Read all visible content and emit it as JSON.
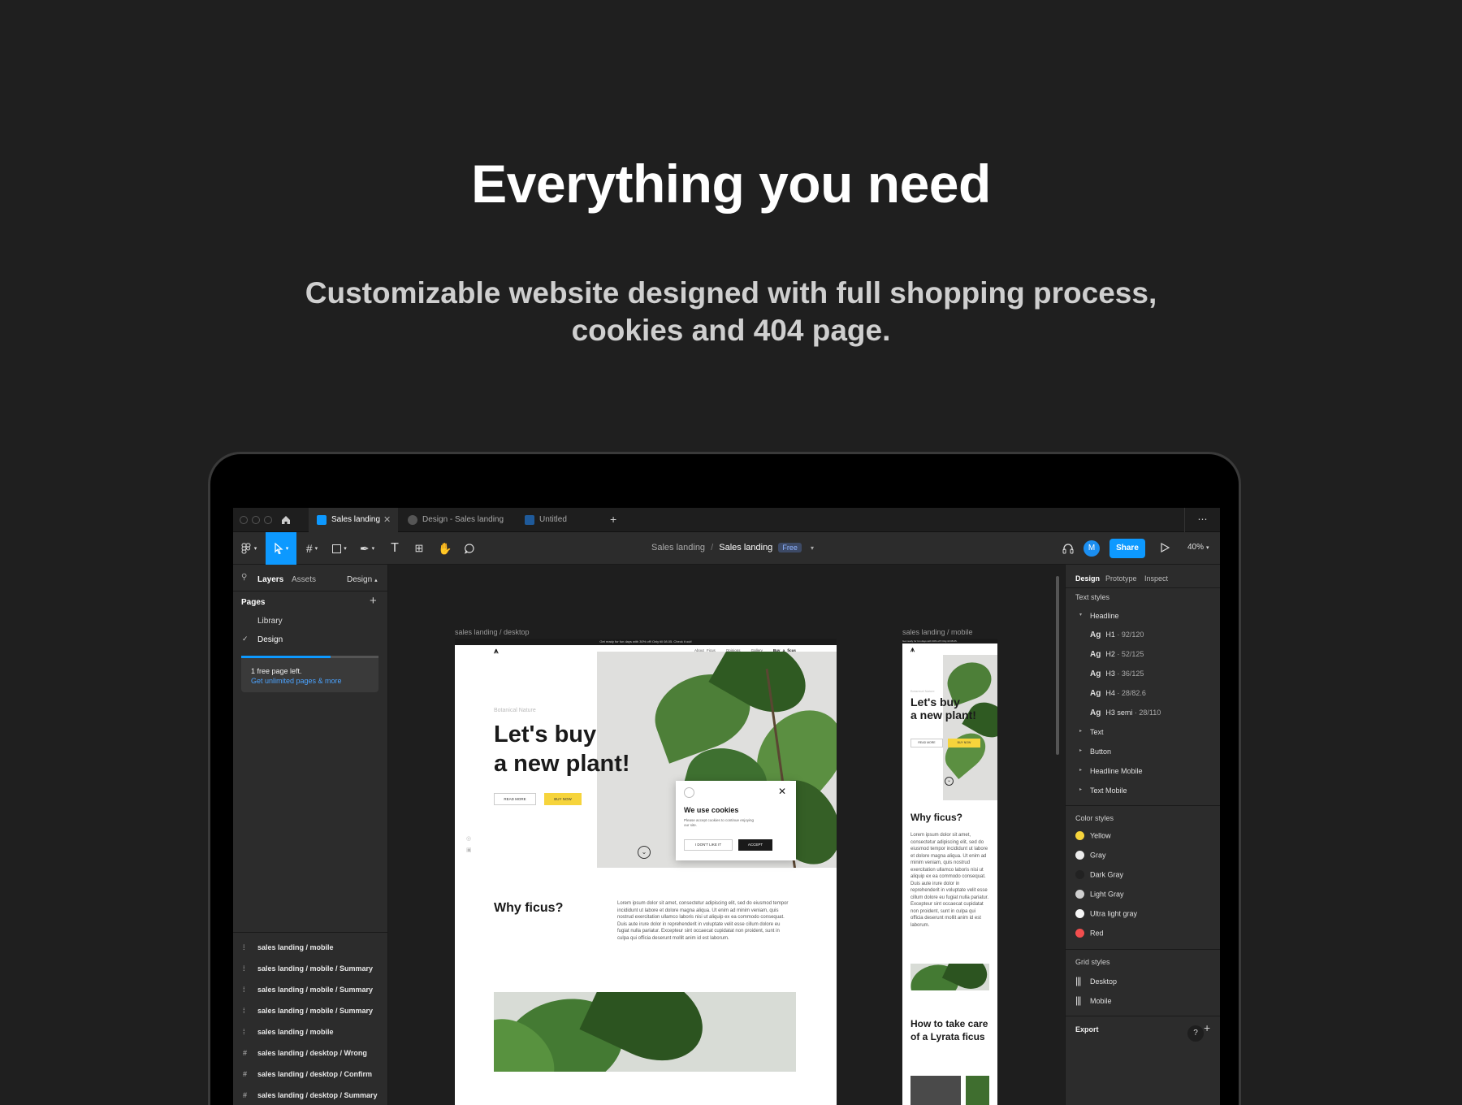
{
  "hero": {
    "title": "Everything you need",
    "subtitle_line1": "Customizable website designed with full shopping  process,",
    "subtitle_line2": "cookies and 404 page."
  },
  "colors": {
    "accent": "#0d99ff",
    "bg": "#1f1f1f",
    "yellow": "#f6d43c",
    "red": "#f24e4e"
  },
  "tabs": [
    {
      "label": "Sales landing",
      "icon": "figma-file-icon"
    },
    {
      "label": "Design - Sales landing",
      "icon": "play-icon"
    },
    {
      "label": "Untitled",
      "icon": "figma-file-icon"
    }
  ],
  "toolbar": {
    "breadcrumb_project": "Sales landing",
    "breadcrumb_sep": "/",
    "breadcrumb_file": "Sales landing",
    "badge": "Free",
    "avatar": "M",
    "share": "Share",
    "zoom": "40%"
  },
  "left_panel": {
    "tab_layers": "Layers",
    "tab_assets": "Assets",
    "tab_design": "Design",
    "pages_heading": "Pages",
    "pages": [
      "Library",
      "Design"
    ],
    "notice_line1": "1 free page left.",
    "notice_link": "Get unlimited pages & more",
    "layers": [
      {
        "icon": "component-icon",
        "label": "sales landing / mobile"
      },
      {
        "icon": "component-icon",
        "label": "sales landing / mobile / Summary"
      },
      {
        "icon": "component-icon",
        "label": "sales landing / mobile / Summary"
      },
      {
        "icon": "component-icon",
        "label": "sales landing / mobile / Summary"
      },
      {
        "icon": "component-icon",
        "label": "sales landing / mobile"
      },
      {
        "icon": "frame-icon",
        "label": "sales landing / desktop / Wrong"
      },
      {
        "icon": "frame-icon",
        "label": "sales landing / desktop / Confirm"
      },
      {
        "icon": "frame-icon",
        "label": "sales landing / desktop / Summary"
      }
    ]
  },
  "right_panel": {
    "tabs": [
      "Design",
      "Prototype",
      "Inspect"
    ],
    "text_styles_heading": "Text styles",
    "headline_group": "Headline",
    "headline_styles": [
      {
        "name": "H1",
        "meta": "92/120"
      },
      {
        "name": "H2",
        "meta": "52/125"
      },
      {
        "name": "H3",
        "meta": "36/125"
      },
      {
        "name": "H4",
        "meta": "28/82.6"
      },
      {
        "name": "H3 semi",
        "meta": "28/110"
      }
    ],
    "ag": "Ag",
    "groups": [
      "Text",
      "Button",
      "Headline Mobile",
      "Text Mobile"
    ],
    "color_styles_heading": "Color styles",
    "color_styles": [
      {
        "name": "Yellow",
        "color": "#f6d43c"
      },
      {
        "name": "Gray",
        "color": "#ececec"
      },
      {
        "name": "Dark Gray",
        "color": "#222222"
      },
      {
        "name": "Light Gray",
        "color": "#cfcfcf"
      },
      {
        "name": "Ultra light gray",
        "color": "#f7f7f7"
      },
      {
        "name": "Red",
        "color": "#f24e4e"
      }
    ],
    "grid_styles_heading": "Grid styles",
    "grid_styles": [
      "Desktop",
      "Mobile"
    ],
    "export": "Export"
  },
  "canvas": {
    "desktop_label": "sales landing / desktop",
    "mobile_label": "sales landing / mobile",
    "desktop": {
      "promo": "Get ready for fun days with 30% off! Only till 08.05. Check it out!",
      "nav": [
        "About Ficus",
        "Opinions",
        "Gallery",
        "Buy a ficus"
      ],
      "eyebrow": "Botanical Nature",
      "headline1": "Let's buy",
      "headline2": "a new plant!",
      "read_more": "READ MORE",
      "buy_now": "BUY NOW",
      "cookie_title": "We use cookies",
      "cookie_text": "Please accept cookies to continue enjoying our site.",
      "cookie_decline": "I DON'T LIKE IT",
      "cookie_accept": "ACCEPT",
      "why_title": "Why ficus?",
      "why_text": "Lorem ipsum dolor sit amet, consectetur adipiscing elit, sed do eiusmod tempor incididunt ut labore et dolore magna aliqua. Ut enim ad minim veniam, quis nostrud exercitation ullamco laboris nisi ut aliquip ex ea commodo consequat. Duis aute irure dolor in reprehenderit in voluptate velit esse cillum dolore eu fugiat nulla pariatur. Excepteur sint occaecat cupidatat non proident, sunt in culpa qui officia deserunt mollit anim id est laborum."
    },
    "mobile": {
      "promo": "Get ready for fun days with 30% off! Only till 08.05.",
      "eyebrow": "Botanical Nature",
      "headline1": "Let's buy",
      "headline2": "a new plant!",
      "read_more": "READ MORE",
      "buy_now": "BUY NOW",
      "why_title": "Why ficus?",
      "why_text": "Lorem ipsum dolor sit amet, consectetur adipiscing elit, sed do eiusmod tempor incididunt ut labore et dolore magna aliqua. Ut enim ad minim veniam, quis nostrud exercitation ullamco laboris nisi ut aliquip ex ea commodo consequat. Duis aute irure dolor in reprehenderit in voluptate velit esse cillum dolore eu fugiat nulla pariatur. Excepteur sint occaecat cupidatat non proident, sunt in culpa qui officia deserunt mollit anim id est laborum.",
      "care_title": "How to take care of a Lyrata ficus"
    }
  }
}
